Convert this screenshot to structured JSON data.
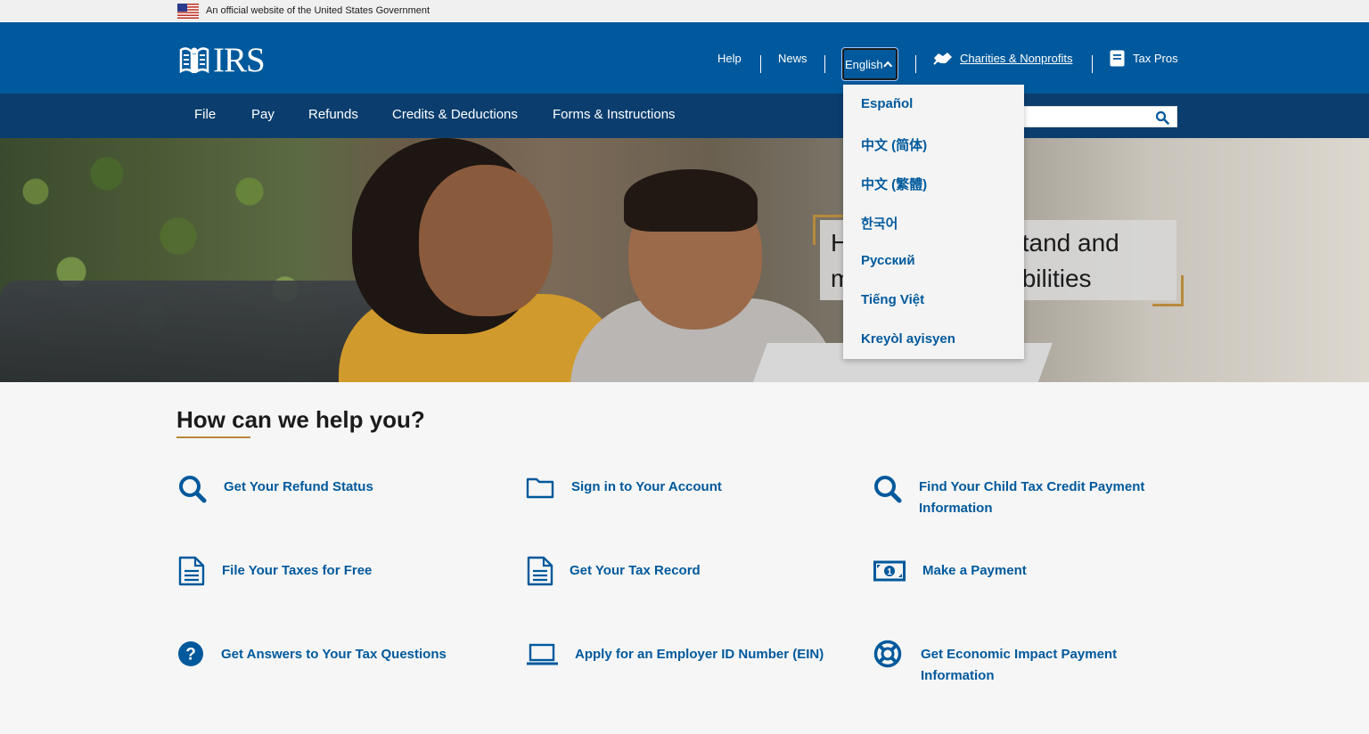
{
  "gov_banner": {
    "text": "An official website of the United States Government"
  },
  "header": {
    "logo_text": "IRS",
    "links": {
      "help": "Help",
      "news": "News",
      "charities": "Charities & Nonprofits",
      "tax_pros": "Tax Pros"
    },
    "language": {
      "selected": "English",
      "expanded": true,
      "options": [
        "Español",
        "中文 (简体)",
        "中文 (繁體)",
        "한국어",
        "Русский",
        "Tiếng Việt",
        "Kreyòl ayisyen"
      ]
    }
  },
  "nav": {
    "items": [
      "File",
      "Pay",
      "Refunds",
      "Credits & Deductions",
      "Forms & Instructions"
    ],
    "search_placeholder": ""
  },
  "hero": {
    "headline_visible": "H                  derstand and\nm                  onsibilities"
  },
  "help": {
    "title": "How can we help you?",
    "tasks": [
      "Get Your Refund Status",
      "Sign in to Your Account",
      "Find Your Child Tax Credit Payment Information",
      "File Your Taxes for Free",
      "Get Your Tax Record",
      "Make a Payment",
      "Get Answers to Your Tax Questions",
      "Apply for an Employer ID Number (EIN)",
      "Get Economic Impact Payment Information"
    ]
  },
  "colors": {
    "header": "#00599c",
    "nav": "#0b3e6e",
    "link": "#00599c",
    "accent": "#b68a3c"
  }
}
